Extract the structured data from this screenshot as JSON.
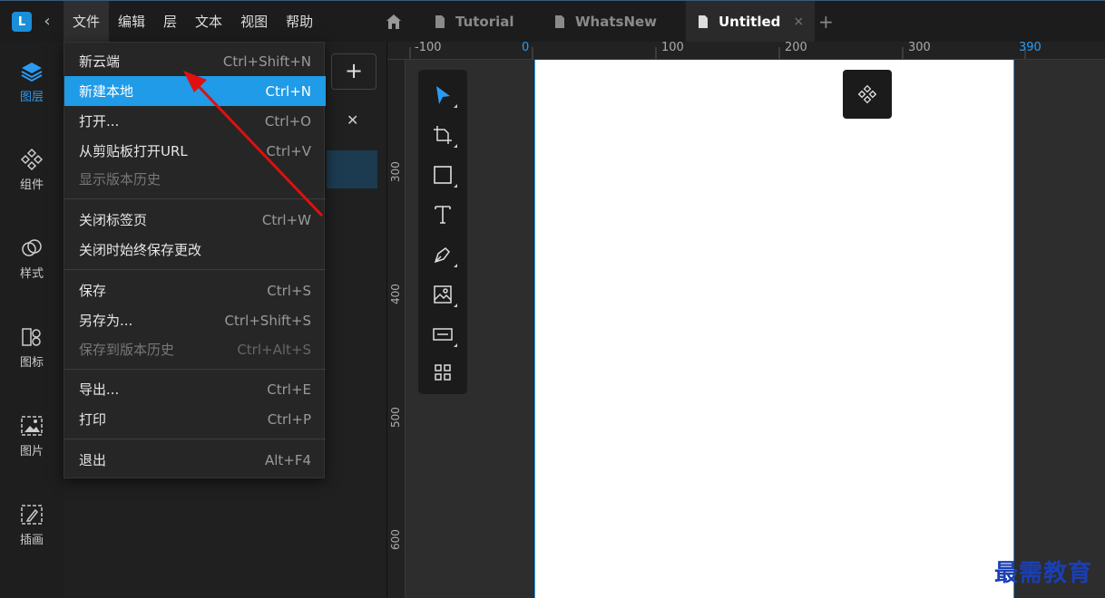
{
  "menubar": [
    "文件",
    "编辑",
    "层",
    "文本",
    "视图",
    "帮助"
  ],
  "tabs": [
    {
      "label": "Tutorial",
      "active": false
    },
    {
      "label": "WhatsNew",
      "active": false
    },
    {
      "label": "Untitled",
      "active": true,
      "close": "×"
    }
  ],
  "logo": "L",
  "tab_add": "+",
  "sidebar": [
    {
      "label": "图层",
      "icon": "layers-icon"
    },
    {
      "label": "组件",
      "icon": "components-icon"
    },
    {
      "label": "样式",
      "icon": "styles-icon"
    },
    {
      "label": "图标",
      "icon": "icons-icon"
    },
    {
      "label": "图片",
      "icon": "image-icon"
    },
    {
      "label": "插画",
      "icon": "illustration-icon"
    }
  ],
  "panel": {
    "add": "+"
  },
  "file_menu": [
    {
      "label": "新云端",
      "shortcut": "Ctrl+Shift+N"
    },
    {
      "label": "新建本地",
      "shortcut": "Ctrl+N",
      "highlighted": true
    },
    {
      "label": "打开...",
      "shortcut": "Ctrl+O"
    },
    {
      "label": "从剪贴板打开URL",
      "shortcut": "Ctrl+V"
    },
    {
      "label": "显示版本历史",
      "shortcut": "",
      "disabled": true
    },
    {
      "label": "关闭标签页",
      "shortcut": "Ctrl+W"
    },
    {
      "label": "关闭时始终保存更改",
      "shortcut": ""
    },
    {
      "label": "保存",
      "shortcut": "Ctrl+S"
    },
    {
      "label": "另存为...",
      "shortcut": "Ctrl+Shift+S"
    },
    {
      "label": "保存到版本历史",
      "shortcut": "Ctrl+Alt+S",
      "disabled": true
    },
    {
      "label": "导出...",
      "shortcut": "Ctrl+E"
    },
    {
      "label": "打印",
      "shortcut": "Ctrl+P"
    },
    {
      "label": "退出",
      "shortcut": "Alt+F4"
    }
  ],
  "ruler_top": [
    "-100",
    "0",
    "100",
    "200",
    "300",
    "390"
  ],
  "ruler_left": [
    "300",
    "400",
    "500",
    "600"
  ],
  "colors": {
    "accent": "#1f9be8",
    "arrow": "#e01010"
  },
  "watermark": "最需教育"
}
